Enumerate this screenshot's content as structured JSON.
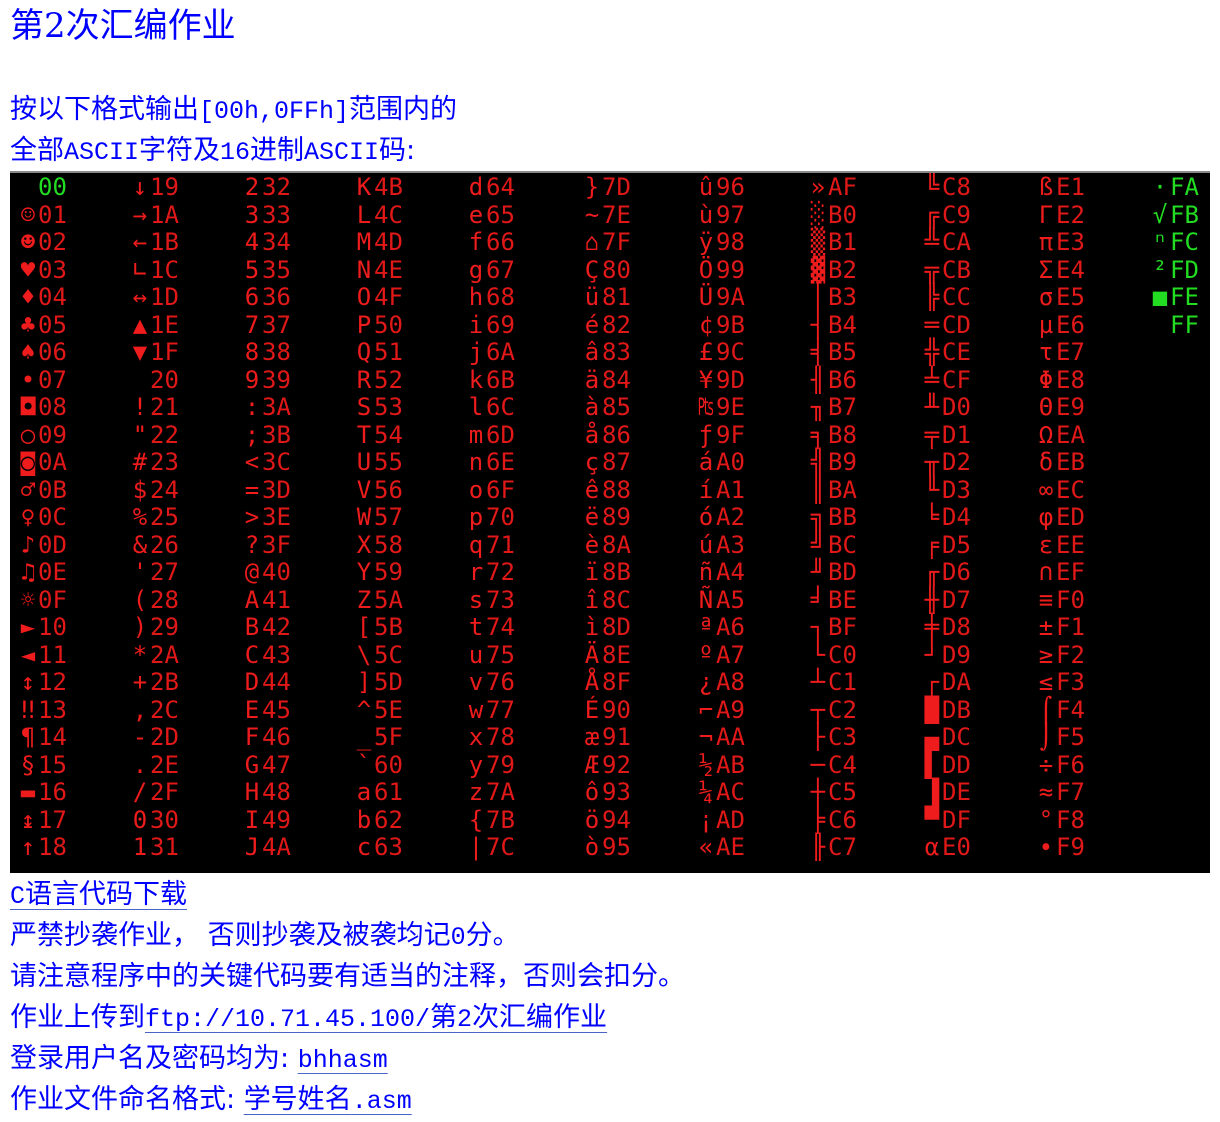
{
  "title": "第2次汇编作业",
  "intro": {
    "line1_prefix": "按以下格式输出",
    "line1_range": "[00h,0FFh]",
    "line1_suffix": "范围内的",
    "line2_p1": "全部",
    "line2_ascii": "ASCII",
    "line2_p2": "字符及",
    "line2_num": "16",
    "line2_p3": "进制",
    "line2_ascii2": "ASCII",
    "line2_p4": "码:"
  },
  "screen": {
    "columns": [
      [
        [
          "",
          "00"
        ],
        [
          "☺",
          "01"
        ],
        [
          "☻",
          "02"
        ],
        [
          "♥",
          "03"
        ],
        [
          "♦",
          "04"
        ],
        [
          "♣",
          "05"
        ],
        [
          "♠",
          "06"
        ],
        [
          "•",
          "07"
        ],
        [
          "◘",
          "08"
        ],
        [
          "○",
          "09"
        ],
        [
          "◙",
          "0A"
        ],
        [
          "♂",
          "0B"
        ],
        [
          "♀",
          "0C"
        ],
        [
          "♪",
          "0D"
        ],
        [
          "♫",
          "0E"
        ],
        [
          "☼",
          "0F"
        ],
        [
          "►",
          "10"
        ],
        [
          "◄",
          "11"
        ],
        [
          "↕",
          "12"
        ],
        [
          "‼",
          "13"
        ],
        [
          "¶",
          "14"
        ],
        [
          "§",
          "15"
        ],
        [
          "▬",
          "16"
        ],
        [
          "↨",
          "17"
        ],
        [
          "↑",
          "18"
        ]
      ],
      [
        [
          "↓",
          "19"
        ],
        [
          "→",
          "1A"
        ],
        [
          "←",
          "1B"
        ],
        [
          "∟",
          "1C"
        ],
        [
          "↔",
          "1D"
        ],
        [
          "▲",
          "1E"
        ],
        [
          "▼",
          "1F"
        ],
        [
          " ",
          "20"
        ],
        [
          "!",
          "21"
        ],
        [
          "\"",
          "22"
        ],
        [
          "#",
          "23"
        ],
        [
          "$",
          "24"
        ],
        [
          "%",
          "25"
        ],
        [
          "&",
          "26"
        ],
        [
          "'",
          "27"
        ],
        [
          "(",
          "28"
        ],
        [
          ")",
          "29"
        ],
        [
          "*",
          "2A"
        ],
        [
          "+",
          "2B"
        ],
        [
          ",",
          "2C"
        ],
        [
          "-",
          "2D"
        ],
        [
          ".",
          "2E"
        ],
        [
          "/",
          "2F"
        ],
        [
          "0",
          "30"
        ],
        [
          "1",
          "31"
        ]
      ],
      [
        [
          "2",
          "32"
        ],
        [
          "3",
          "33"
        ],
        [
          "4",
          "34"
        ],
        [
          "5",
          "35"
        ],
        [
          "6",
          "36"
        ],
        [
          "7",
          "37"
        ],
        [
          "8",
          "38"
        ],
        [
          "9",
          "39"
        ],
        [
          ":",
          "3A"
        ],
        [
          ";",
          "3B"
        ],
        [
          "<",
          "3C"
        ],
        [
          "=",
          "3D"
        ],
        [
          ">",
          "3E"
        ],
        [
          "?",
          "3F"
        ],
        [
          "@",
          "40"
        ],
        [
          "A",
          "41"
        ],
        [
          "B",
          "42"
        ],
        [
          "C",
          "43"
        ],
        [
          "D",
          "44"
        ],
        [
          "E",
          "45"
        ],
        [
          "F",
          "46"
        ],
        [
          "G",
          "47"
        ],
        [
          "H",
          "48"
        ],
        [
          "I",
          "49"
        ],
        [
          "J",
          "4A"
        ]
      ],
      [
        [
          "K",
          "4B"
        ],
        [
          "L",
          "4C"
        ],
        [
          "M",
          "4D"
        ],
        [
          "N",
          "4E"
        ],
        [
          "O",
          "4F"
        ],
        [
          "P",
          "50"
        ],
        [
          "Q",
          "51"
        ],
        [
          "R",
          "52"
        ],
        [
          "S",
          "53"
        ],
        [
          "T",
          "54"
        ],
        [
          "U",
          "55"
        ],
        [
          "V",
          "56"
        ],
        [
          "W",
          "57"
        ],
        [
          "X",
          "58"
        ],
        [
          "Y",
          "59"
        ],
        [
          "Z",
          "5A"
        ],
        [
          "[",
          "5B"
        ],
        [
          "\\",
          "5C"
        ],
        [
          "]",
          "5D"
        ],
        [
          "^",
          "5E"
        ],
        [
          "_",
          "5F"
        ],
        [
          "`",
          "60"
        ],
        [
          "a",
          "61"
        ],
        [
          "b",
          "62"
        ],
        [
          "c",
          "63"
        ]
      ],
      [
        [
          "d",
          "64"
        ],
        [
          "e",
          "65"
        ],
        [
          "f",
          "66"
        ],
        [
          "g",
          "67"
        ],
        [
          "h",
          "68"
        ],
        [
          "i",
          "69"
        ],
        [
          "j",
          "6A"
        ],
        [
          "k",
          "6B"
        ],
        [
          "l",
          "6C"
        ],
        [
          "m",
          "6D"
        ],
        [
          "n",
          "6E"
        ],
        [
          "o",
          "6F"
        ],
        [
          "p",
          "70"
        ],
        [
          "q",
          "71"
        ],
        [
          "r",
          "72"
        ],
        [
          "s",
          "73"
        ],
        [
          "t",
          "74"
        ],
        [
          "u",
          "75"
        ],
        [
          "v",
          "76"
        ],
        [
          "w",
          "77"
        ],
        [
          "x",
          "78"
        ],
        [
          "y",
          "79"
        ],
        [
          "z",
          "7A"
        ],
        [
          "{",
          "7B"
        ],
        [
          "|",
          "7C"
        ]
      ],
      [
        [
          "}",
          "7D"
        ],
        [
          "~",
          "7E"
        ],
        [
          "⌂",
          "7F"
        ],
        [
          "Ç",
          "80"
        ],
        [
          "ü",
          "81"
        ],
        [
          "é",
          "82"
        ],
        [
          "â",
          "83"
        ],
        [
          "ä",
          "84"
        ],
        [
          "à",
          "85"
        ],
        [
          "å",
          "86"
        ],
        [
          "ç",
          "87"
        ],
        [
          "ê",
          "88"
        ],
        [
          "ë",
          "89"
        ],
        [
          "è",
          "8A"
        ],
        [
          "ï",
          "8B"
        ],
        [
          "î",
          "8C"
        ],
        [
          "ì",
          "8D"
        ],
        [
          "Ä",
          "8E"
        ],
        [
          "Å",
          "8F"
        ],
        [
          "É",
          "90"
        ],
        [
          "æ",
          "91"
        ],
        [
          "Æ",
          "92"
        ],
        [
          "ô",
          "93"
        ],
        [
          "ö",
          "94"
        ],
        [
          "ò",
          "95"
        ]
      ],
      [
        [
          "û",
          "96"
        ],
        [
          "ù",
          "97"
        ],
        [
          "ÿ",
          "98"
        ],
        [
          "Ö",
          "99"
        ],
        [
          "Ü",
          "9A"
        ],
        [
          "¢",
          "9B"
        ],
        [
          "£",
          "9C"
        ],
        [
          "¥",
          "9D"
        ],
        [
          "₧",
          "9E"
        ],
        [
          "ƒ",
          "9F"
        ],
        [
          "á",
          "A0"
        ],
        [
          "í",
          "A1"
        ],
        [
          "ó",
          "A2"
        ],
        [
          "ú",
          "A3"
        ],
        [
          "ñ",
          "A4"
        ],
        [
          "Ñ",
          "A5"
        ],
        [
          "ª",
          "A6"
        ],
        [
          "º",
          "A7"
        ],
        [
          "¿",
          "A8"
        ],
        [
          "⌐",
          "A9"
        ],
        [
          "¬",
          "AA"
        ],
        [
          "½",
          "AB"
        ],
        [
          "¼",
          "AC"
        ],
        [
          "¡",
          "AD"
        ],
        [
          "«",
          "AE"
        ]
      ],
      [
        [
          "»",
          "AF"
        ],
        [
          "░",
          "B0"
        ],
        [
          "▒",
          "B1"
        ],
        [
          "▓",
          "B2"
        ],
        [
          "│",
          "B3"
        ],
        [
          "┤",
          "B4"
        ],
        [
          "╡",
          "B5"
        ],
        [
          "╢",
          "B6"
        ],
        [
          "╖",
          "B7"
        ],
        [
          "╕",
          "B8"
        ],
        [
          "╣",
          "B9"
        ],
        [
          "║",
          "BA"
        ],
        [
          "╗",
          "BB"
        ],
        [
          "╝",
          "BC"
        ],
        [
          "╜",
          "BD"
        ],
        [
          "╛",
          "BE"
        ],
        [
          "┐",
          "BF"
        ],
        [
          "└",
          "C0"
        ],
        [
          "┴",
          "C1"
        ],
        [
          "┬",
          "C2"
        ],
        [
          "├",
          "C3"
        ],
        [
          "─",
          "C4"
        ],
        [
          "┼",
          "C5"
        ],
        [
          "╞",
          "C6"
        ],
        [
          "╟",
          "C7"
        ]
      ],
      [
        [
          "╚",
          "C8"
        ],
        [
          "╔",
          "C9"
        ],
        [
          "╩",
          "CA"
        ],
        [
          "╦",
          "CB"
        ],
        [
          "╠",
          "CC"
        ],
        [
          "═",
          "CD"
        ],
        [
          "╬",
          "CE"
        ],
        [
          "╧",
          "CF"
        ],
        [
          "╨",
          "D0"
        ],
        [
          "╤",
          "D1"
        ],
        [
          "╥",
          "D2"
        ],
        [
          "╙",
          "D3"
        ],
        [
          "╘",
          "D4"
        ],
        [
          "╒",
          "D5"
        ],
        [
          "╓",
          "D6"
        ],
        [
          "╫",
          "D7"
        ],
        [
          "╪",
          "D8"
        ],
        [
          "┘",
          "D9"
        ],
        [
          "┌",
          "DA"
        ],
        [
          "█",
          "DB"
        ],
        [
          "▄",
          "DC"
        ],
        [
          "▌",
          "DD"
        ],
        [
          "▐",
          "DE"
        ],
        [
          "▀",
          "DF"
        ],
        [
          "α",
          "E0"
        ]
      ],
      [
        [
          "ß",
          "E1"
        ],
        [
          "Γ",
          "E2"
        ],
        [
          "π",
          "E3"
        ],
        [
          "Σ",
          "E4"
        ],
        [
          "σ",
          "E5"
        ],
        [
          "µ",
          "E6"
        ],
        [
          "τ",
          "E7"
        ],
        [
          "Φ",
          "E8"
        ],
        [
          "Θ",
          "E9"
        ],
        [
          "Ω",
          "EA"
        ],
        [
          "δ",
          "EB"
        ],
        [
          "∞",
          "EC"
        ],
        [
          "φ",
          "ED"
        ],
        [
          "ε",
          "EE"
        ],
        [
          "∩",
          "EF"
        ],
        [
          "≡",
          "F0"
        ],
        [
          "±",
          "F1"
        ],
        [
          "≥",
          "F2"
        ],
        [
          "≤",
          "F3"
        ],
        [
          "⌠",
          "F4"
        ],
        [
          "⌡",
          "F5"
        ],
        [
          "÷",
          "F6"
        ],
        [
          "≈",
          "F7"
        ],
        [
          "°",
          "F8"
        ],
        [
          "∙",
          "F9"
        ]
      ],
      [
        [
          "·",
          "FA"
        ],
        [
          "√",
          "FB"
        ],
        [
          "ⁿ",
          "FC"
        ],
        [
          "²",
          "FD"
        ],
        [
          "■",
          "FE"
        ],
        [
          " ",
          "FF"
        ]
      ]
    ],
    "colors": {
      "background": "#000000",
      "red": "#ee1c1c",
      "green": "#22dd22"
    }
  },
  "links": {
    "c_code_prefix": "C",
    "c_code_label": "语言代码下载"
  },
  "rules": {
    "no_copy_p1": "严禁抄袭作业， 否则抄袭及被袭均记",
    "no_copy_zero": "0",
    "no_copy_p2": "分。",
    "comments": "请注意程序中的关键代码要有适当的注释，否则会扣分。"
  },
  "upload": {
    "label": "作业上传到",
    "url_prefix": "ftp://10.71.45.100/",
    "url_p1": "第",
    "url_num": "2",
    "url_p2": "次汇编作业"
  },
  "login": {
    "label": "登录用户名及密码均为: ",
    "value": "bhhasm"
  },
  "filename": {
    "label": "作业文件命名格式: ",
    "value_text": "学号姓名",
    "value_ext": ".asm"
  }
}
